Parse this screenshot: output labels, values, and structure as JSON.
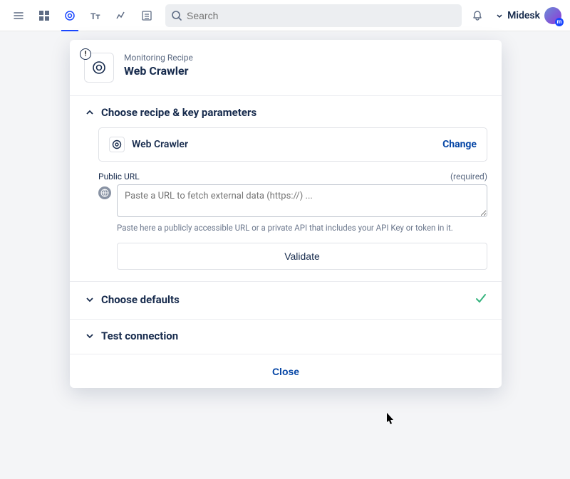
{
  "topbar": {
    "search_placeholder": "Search",
    "user_name": "Midesk"
  },
  "modal": {
    "header": {
      "subtitle": "Monitoring Recipe",
      "title": "Web Crawler"
    },
    "section1": {
      "title": "Choose recipe & key parameters",
      "selected_recipe": "Web Crawler",
      "change_label": "Change",
      "url_field": {
        "label": "Public URL",
        "required": "(required)",
        "placeholder": "Paste a URL to fetch external data (https://) ...",
        "helper": "Paste here a publicly accessible URL or a private API that includes your API Key or token in it."
      },
      "validate_label": "Validate"
    },
    "section2": {
      "title": "Choose defaults"
    },
    "section3": {
      "title": "Test connection"
    },
    "close_label": "Close"
  }
}
